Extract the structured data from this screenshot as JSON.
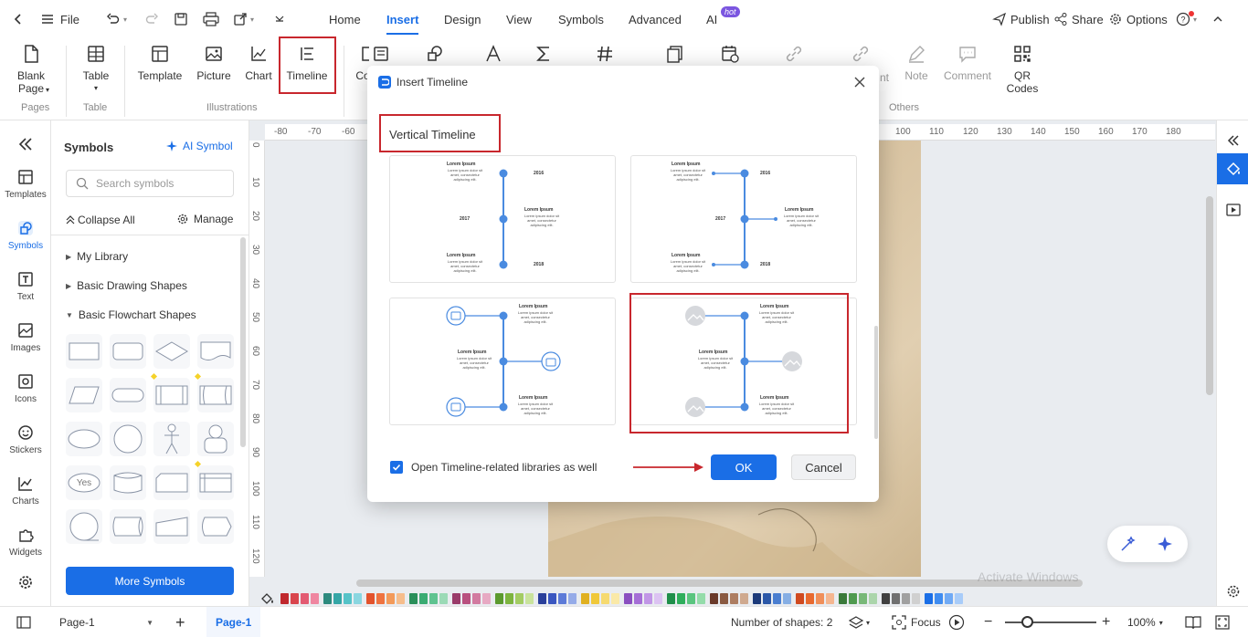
{
  "titlebar": {
    "file_label": "File",
    "tabs": [
      {
        "label": "Home"
      },
      {
        "label": "Insert"
      },
      {
        "label": "Design"
      },
      {
        "label": "View"
      },
      {
        "label": "Symbols"
      },
      {
        "label": "Advanced"
      },
      {
        "label": "AI"
      }
    ],
    "hot_badge": "hot",
    "publish": "Publish",
    "share": "Share",
    "options": "Options"
  },
  "ribbon": {
    "blank_page": "Blank Page",
    "table": "Table",
    "template": "Template",
    "picture": "Picture",
    "chart": "Chart",
    "timeline": "Timeline",
    "co": "Co",
    "nt": "nt",
    "note": "Note",
    "comment": "Comment",
    "qr_codes": "QR Codes",
    "groups": {
      "pages": "Pages",
      "table": "Table",
      "illustrations": "Illustrations",
      "others": "Others"
    }
  },
  "leftrail": {
    "items": [
      {
        "label": "Templates"
      },
      {
        "label": "Symbols"
      },
      {
        "label": "Text"
      },
      {
        "label": "Images"
      },
      {
        "label": "Icons"
      },
      {
        "label": "Stickers"
      },
      {
        "label": "Charts"
      },
      {
        "label": "Widgets"
      }
    ]
  },
  "symbols_panel": {
    "title": "Symbols",
    "ai_symbol": "AI Symbol",
    "search_placeholder": "Search symbols",
    "collapse_all": "Collapse All",
    "manage": "Manage",
    "libraries": [
      {
        "label": "My Library"
      },
      {
        "label": "Basic Drawing Shapes"
      },
      {
        "label": "Basic Flowchart Shapes"
      }
    ],
    "yes_label": "Yes",
    "more_symbols": "More Symbols"
  },
  "rulers": {
    "h": [
      "-80",
      "-70",
      "-60",
      "100",
      "110",
      "120",
      "130",
      "140",
      "150",
      "160",
      "170",
      "180"
    ],
    "v": [
      "0",
      "10",
      "20",
      "30",
      "40",
      "50",
      "60",
      "70",
      "80",
      "90",
      "100",
      "110",
      "120"
    ]
  },
  "dialog": {
    "title": "Insert Timeline",
    "section_title": "Vertical Timeline",
    "lorem_title": "Lorem Ipsum",
    "lorem_body": "Lorem ipsum dolor sit amet, consectetur adipiscing elit.",
    "years": [
      "2016",
      "2017",
      "2018"
    ],
    "checkbox_label": "Open Timeline-related libraries as well",
    "checkbox_checked": true,
    "ok": "OK",
    "cancel": "Cancel"
  },
  "statusbar": {
    "page_select": "Page-1",
    "page_tab": "Page-1",
    "shape_count": "Number of shapes: 2",
    "focus": "Focus",
    "zoom": "100%",
    "activate_windows": "Activate Windows"
  },
  "colors": {
    "accent": "#1a6ee6",
    "highlight_red": "#c8272d",
    "timeline_blue": "#4a8be0"
  },
  "palette": [
    "#c0282d",
    "#d9454d",
    "#e35b72",
    "#ef86a0",
    "#2d8a7e",
    "#35a6a6",
    "#56c3c8",
    "#8ad6e0",
    "#e3532c",
    "#ef7340",
    "#f39a5a",
    "#f6bd8c",
    "#2a8f5a",
    "#3aab72",
    "#5fc390",
    "#9bdab6",
    "#9a3b6a",
    "#b9507f",
    "#d27aa0",
    "#e7a9c3",
    "#5b9a2e",
    "#7db43f",
    "#a3cc63",
    "#c9e39c",
    "#2a3f9a",
    "#3a56c0",
    "#5d7bd8",
    "#95abe8",
    "#e0b020",
    "#f0c83a",
    "#f6da70",
    "#fae9a8",
    "#8a4fc0",
    "#a56ed6",
    "#c196e6",
    "#dcc3f2",
    "#1f8f4a",
    "#2fae5c",
    "#5ac57f",
    "#94dcaa",
    "#6a3a2a",
    "#8a5a42",
    "#ad7d62",
    "#cfa98f",
    "#1c3a7a",
    "#2c58a8",
    "#4a7ed0",
    "#86aee4",
    "#d04a20",
    "#e86a30",
    "#f08f5a",
    "#f5b690",
    "#3a7a3a",
    "#4f9a4f",
    "#78b878",
    "#abd5ab",
    "#404040",
    "#707070",
    "#a0a0a0",
    "#d0d0d0",
    "#1a6ee6",
    "#3f8cf0",
    "#70aaf5",
    "#a8ccf9"
  ]
}
